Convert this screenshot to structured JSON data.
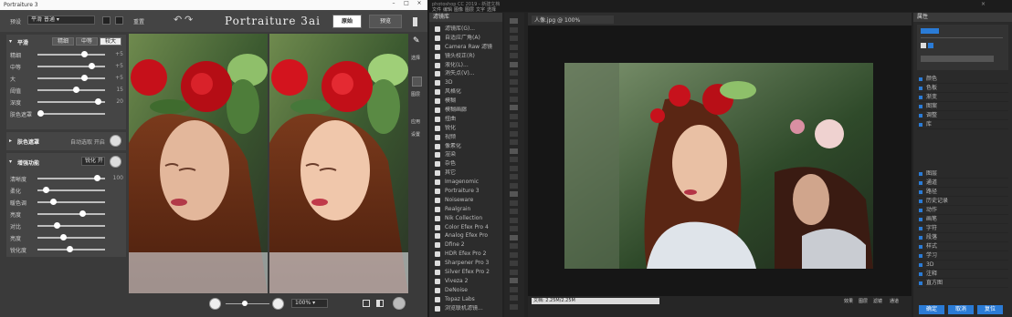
{
  "plugin": {
    "window_title": "Portraiture 3",
    "top_bar": {
      "preset_label": "预设",
      "preset_value": "平滑 普通",
      "reset_label": "重置",
      "logo": "Portraiture 3ai",
      "tab_original": "原始",
      "tab_preview": "预览"
    },
    "smoothing": {
      "title": "平滑",
      "modes": [
        "精细",
        "中等",
        "较大"
      ],
      "active_mode": 2,
      "sliders": [
        {
          "label": "精细",
          "value": "+5",
          "pos": 0.68
        },
        {
          "label": "中等",
          "value": "+5",
          "pos": 0.8
        },
        {
          "label": "大",
          "value": "+5",
          "pos": 0.68
        },
        {
          "label": "阈值",
          "value": "15",
          "pos": 0.55
        },
        {
          "label": "深度",
          "value": "20",
          "pos": 0.9
        },
        {
          "label": "肤色遮罩",
          "value": "",
          "pos": 0.0
        }
      ]
    },
    "skin_mask": {
      "title": "肤色遮罩",
      "mode": "自动选取 开启"
    },
    "enhance": {
      "title": "增强功能",
      "mode": "锐化 开",
      "sliders": [
        {
          "label": "清晰度",
          "value": "100",
          "pos": 0.88
        },
        {
          "label": "柔化",
          "value": "",
          "pos": 0.08
        },
        {
          "label": "暖色调",
          "value": "",
          "pos": 0.2
        },
        {
          "label": "亮度",
          "value": "",
          "pos": 0.66
        },
        {
          "label": "对比",
          "value": "",
          "pos": 0.26
        },
        {
          "label": "亮度",
          "value": "",
          "pos": 0.36
        },
        {
          "label": "锐化度",
          "value": "",
          "pos": 0.46
        }
      ]
    },
    "side_buttons": [
      "选择",
      "图层",
      "应用",
      "设置"
    ],
    "zoom_value": "100%",
    "colors": {
      "accent": "#ffffff",
      "panel": "#454545",
      "background": "#3a3a3a"
    }
  },
  "host": {
    "window_title": "photoshop CC 2019 - 新建文档",
    "menu": [
      "文件",
      "编辑",
      "图像",
      "图层",
      "文字",
      "选择"
    ],
    "left_panel": {
      "title": "滤镜库",
      "items": [
        "滤镜库(G)...",
        "自适应广角(A)",
        "Camera Raw 滤镜",
        "镜头校正(R)",
        "液化(L)...",
        "消失点(V)...",
        "3D",
        "风格化",
        "模糊",
        "模糊画廊",
        "扭曲",
        "锐化",
        "视频",
        "像素化",
        "渲染",
        "杂色",
        "其它",
        "Imagenomic",
        "Portraiture 3",
        "Noiseware",
        "Realgrain",
        "Nik Collection",
        "Color Efex Pro 4",
        "Analog Efex Pro",
        "Dfine 2",
        "HDR Efex Pro 2",
        "Sharpener Pro 3",
        "Silver Efex Pro 2",
        "Viveza 2",
        "DeNoise",
        "Topaz Labs",
        "浏览联机滤镜..."
      ]
    },
    "canvas_tab": "人像.jpg @ 100%",
    "status_left": "文档: 2.25M/2.25M",
    "status_items": [
      "效果",
      "图层",
      "滤镜",
      "通道"
    ],
    "right_panel": {
      "header": "属性",
      "rows": [
        "颜色",
        "色板",
        "渐变",
        "图案",
        "调整",
        "库",
        "图层",
        "通道",
        "路径",
        "历史记录",
        "动作",
        "画笔",
        "字符",
        "段落",
        "样式",
        "学习",
        "3D",
        "注释",
        "直方图"
      ],
      "bottom_buttons": [
        "确定",
        "取消",
        "复位"
      ]
    }
  }
}
